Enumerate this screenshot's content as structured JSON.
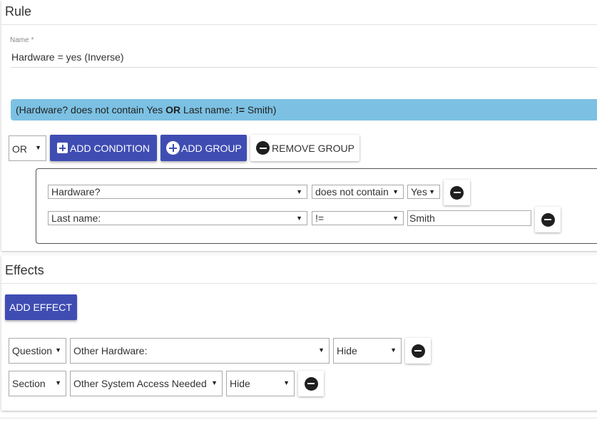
{
  "rule": {
    "title": "Rule",
    "name_label": "Name *",
    "name_value": "Hardware = yes (Inverse)",
    "summary": {
      "part1": "(Hardware? does not contain Yes ",
      "op": "OR",
      "part2": " Last name: ",
      "op2": "!=",
      "part3": " Smith)"
    },
    "group_operator": "OR",
    "add_condition_label": "ADD CONDITION",
    "add_group_label": "ADD GROUP",
    "remove_group_label": "REMOVE GROUP",
    "conditions": [
      {
        "field": "Hardware?",
        "operator": "does not contain",
        "value": "Yes"
      },
      {
        "field": "Last name:",
        "operator": "!=",
        "value": "Smith"
      }
    ]
  },
  "effects": {
    "title": "Effects",
    "add_effect_label": "ADD EFFECT",
    "items": [
      {
        "type": "Question",
        "target": "Other Hardware:",
        "action": "Hide"
      },
      {
        "type": "Section",
        "target": "Other System Access Needed",
        "action": "Hide"
      }
    ]
  },
  "colors": {
    "primary_button": "#3f4db3",
    "summary_bar": "#7cc1e3"
  },
  "icons": {
    "caret": "caret-down-icon",
    "add": "plus-square-icon",
    "add_group": "plus-circle-icon",
    "remove": "minus-circle-icon"
  }
}
